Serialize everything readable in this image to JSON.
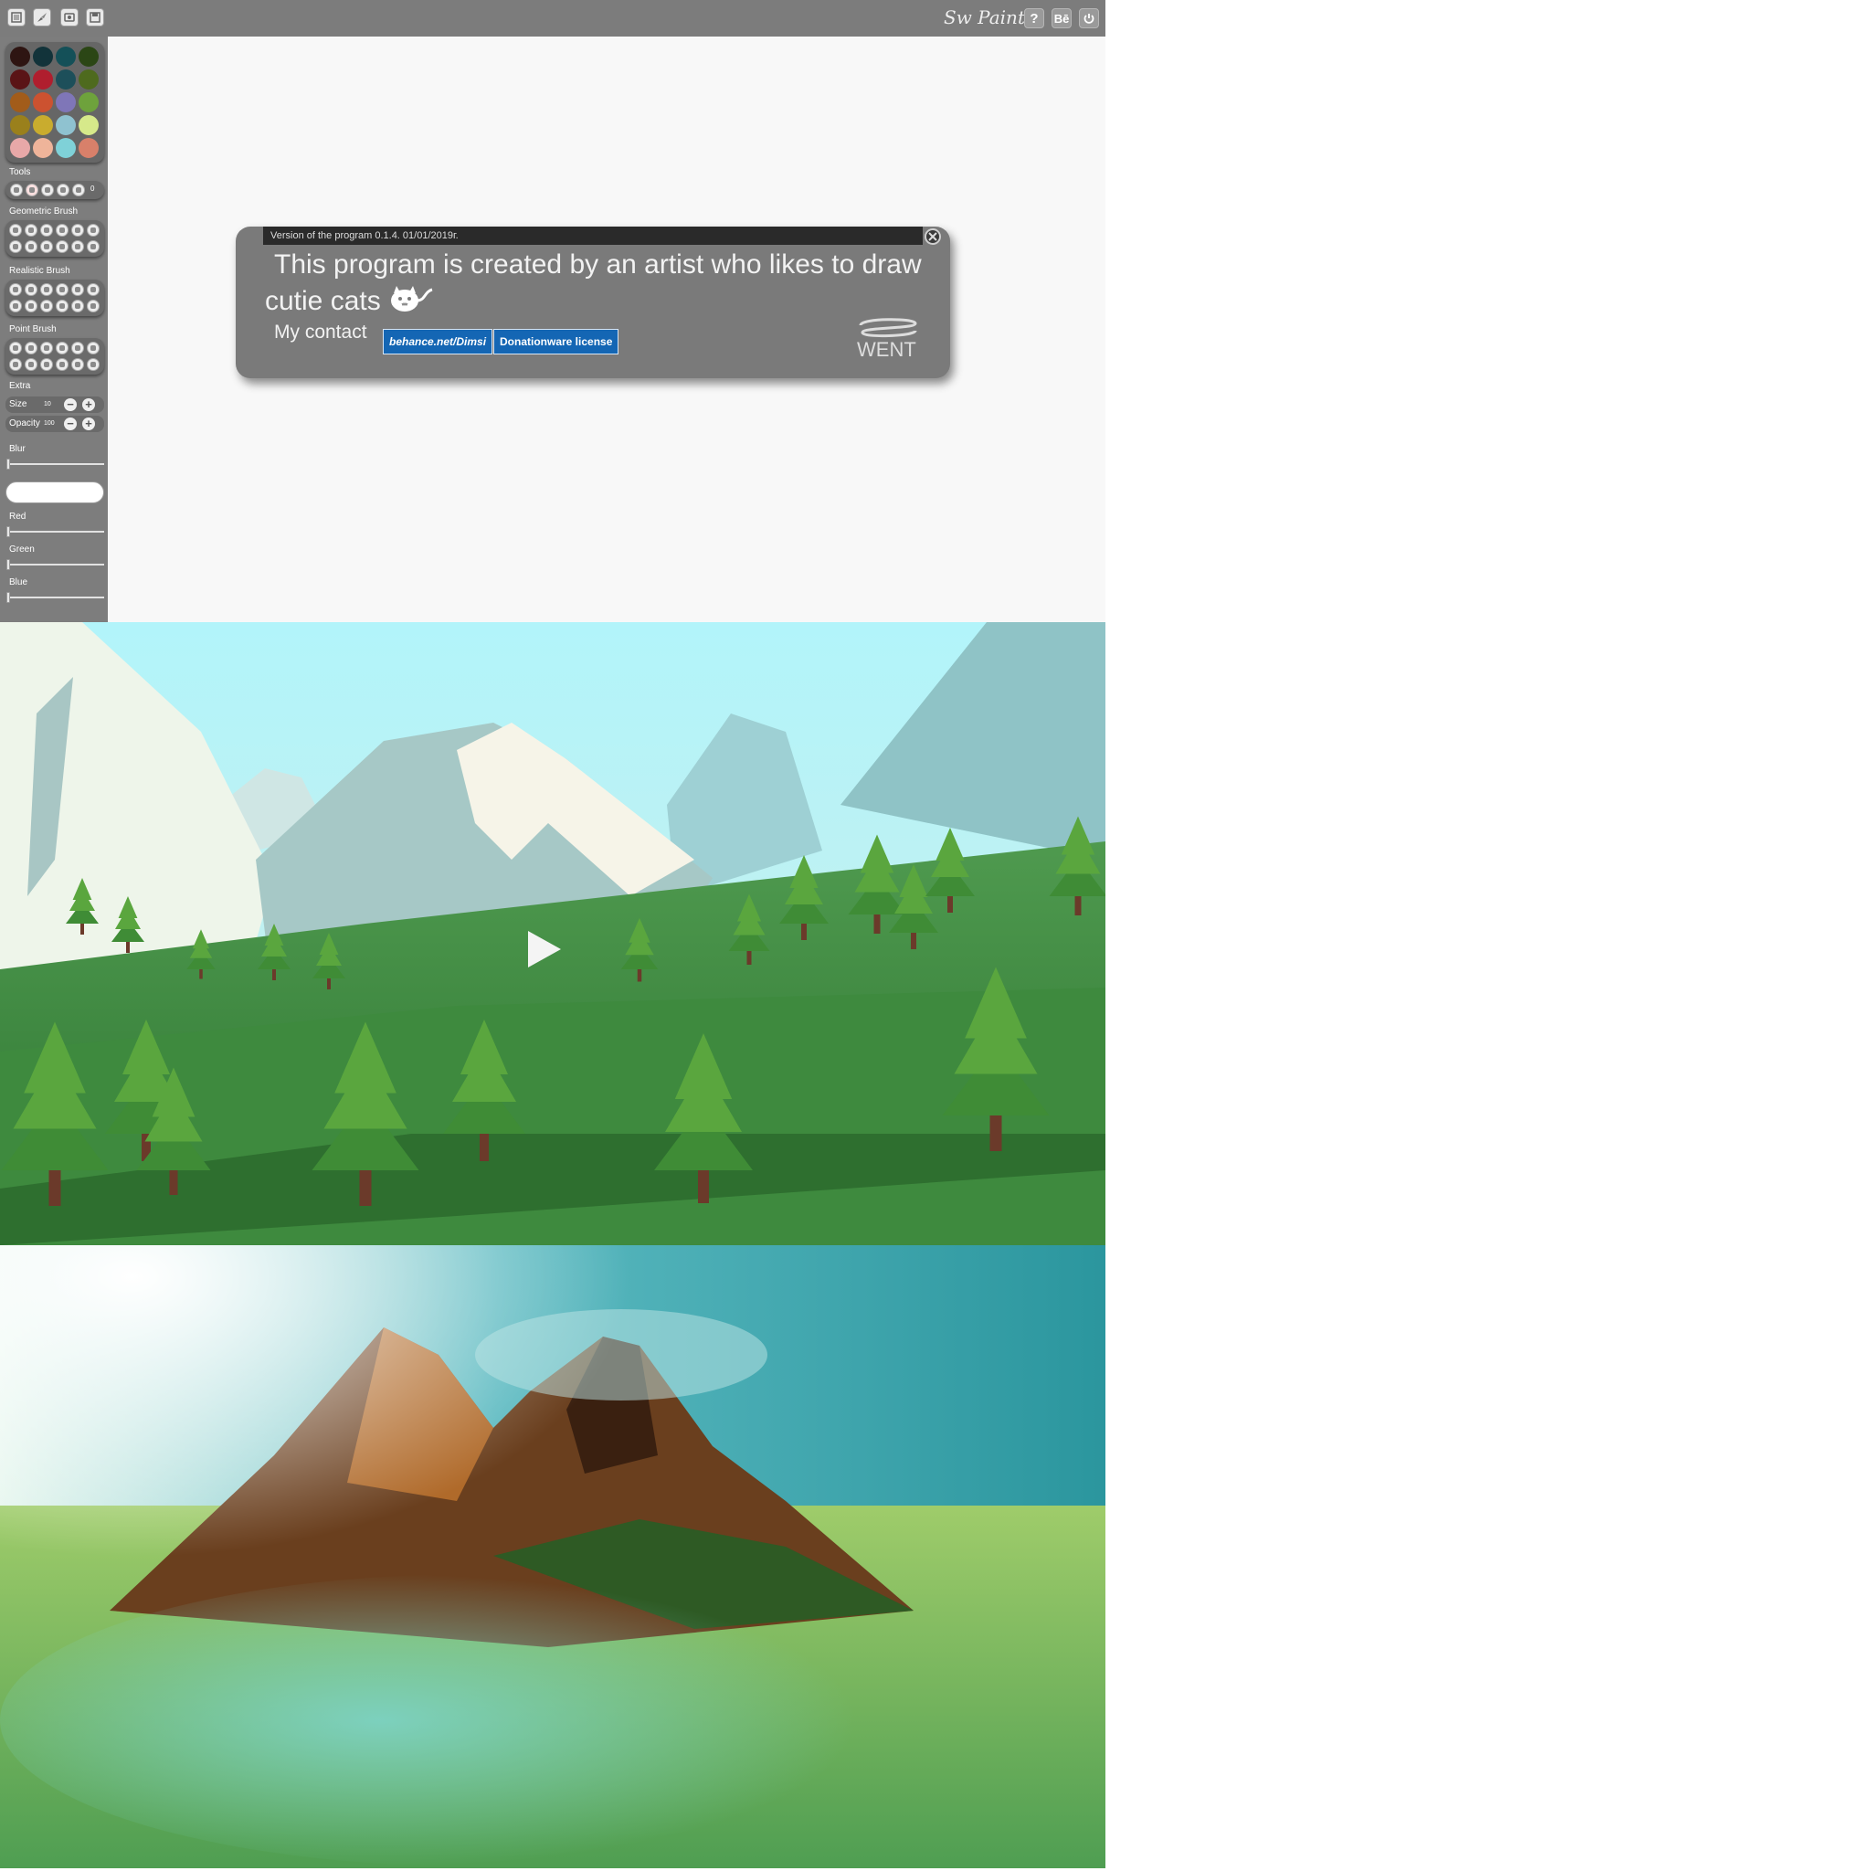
{
  "toolbar": {
    "icons": [
      "menu-icon",
      "brush-icon",
      "camera-icon",
      "save-icon"
    ],
    "app_title": "Sw Paint",
    "help_label": "?",
    "behance_label": "Bē",
    "power_icon": "power-icon"
  },
  "sidebar": {
    "palette_colors": [
      "#2e1512",
      "#12333a",
      "#145058",
      "#2b4615",
      "#5a1416",
      "#b01e2e",
      "#1d4f5a",
      "#4e6a1e",
      "#a25c1a",
      "#cc5230",
      "#7f76b8",
      "#6ea23c",
      "#9a801c",
      "#c9ac2e",
      "#8fc2d0",
      "#d6e98a",
      "#e8a8a8",
      "#efb49a",
      "#7fd1d8",
      "#d8806a"
    ],
    "sections": {
      "tools": "Tools",
      "geometric": "Geometric Brush",
      "realistic": "Realistic Brush",
      "point": "Point Brush",
      "extra": "Extra"
    },
    "tools_value": "0",
    "size_label": "Size",
    "size_value": "10",
    "opacity_label": "Opacity",
    "opacity_value": "100",
    "sliders": {
      "blur": "Blur",
      "red": "Red",
      "green": "Green",
      "blue": "Blue"
    },
    "slider_values": {
      "blur": 0,
      "red": 0,
      "green": 0,
      "blue": 0
    }
  },
  "dialog": {
    "version": "Version of the program  0.1.4.  01/01/2019г.",
    "message": "This program is created by an artist who likes to draw cutie cats",
    "contact_label": "My contact",
    "behance_link": "behance.net/Dimsi",
    "license_link": "Donationware license",
    "logo_text": "WENT"
  }
}
